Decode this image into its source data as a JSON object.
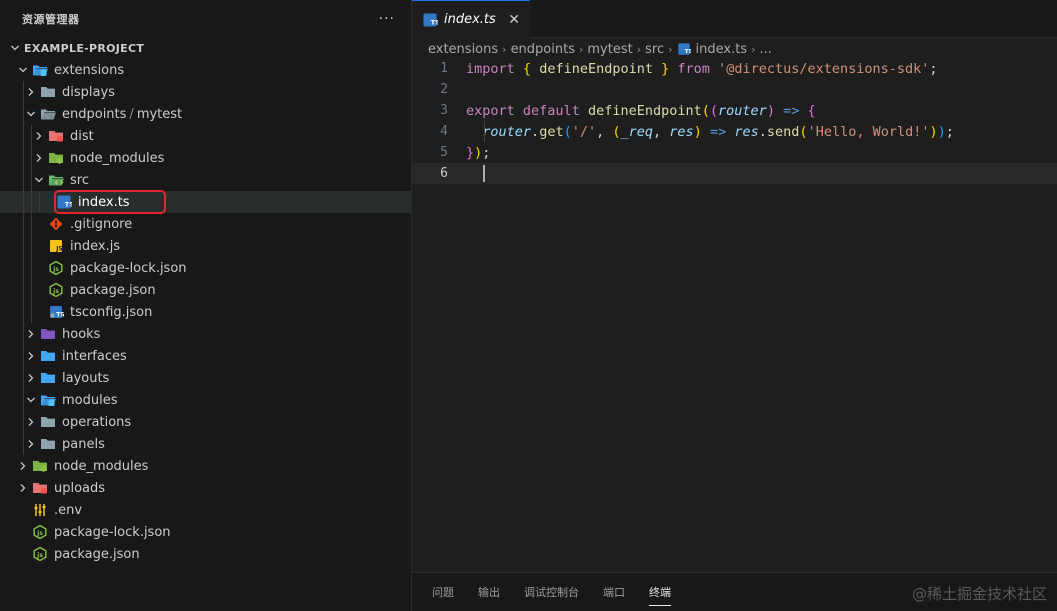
{
  "sidebar": {
    "title": "资源管理器",
    "more": "···",
    "tree": [
      {
        "label": "EXAMPLE-PROJECT",
        "depth": 0,
        "chevron": "down",
        "icon": "none",
        "bold": true
      },
      {
        "label": "extensions",
        "depth": 1,
        "chevron": "down",
        "icon": "folder-ext-open"
      },
      {
        "label": "displays",
        "depth": 2,
        "chevron": "right",
        "icon": "folder-gray"
      },
      {
        "label": "endpoints",
        "extra": "mytest",
        "depth": 2,
        "chevron": "down",
        "icon": "folder-gray-open"
      },
      {
        "label": "dist",
        "depth": 3,
        "chevron": "right",
        "icon": "folder-red"
      },
      {
        "label": "node_modules",
        "depth": 3,
        "chevron": "right",
        "icon": "folder-green"
      },
      {
        "label": "src",
        "depth": 3,
        "chevron": "down",
        "icon": "folder-src-open"
      },
      {
        "label": "index.ts",
        "depth": 4,
        "chevron": "none",
        "icon": "ts-file",
        "selected": true
      },
      {
        "label": ".gitignore",
        "depth": 3,
        "chevron": "none",
        "icon": "git-file"
      },
      {
        "label": "index.js",
        "depth": 3,
        "chevron": "none",
        "icon": "js-file"
      },
      {
        "label": "package-lock.json",
        "depth": 3,
        "chevron": "none",
        "icon": "node-file"
      },
      {
        "label": "package.json",
        "depth": 3,
        "chevron": "none",
        "icon": "node-file"
      },
      {
        "label": "tsconfig.json",
        "depth": 3,
        "chevron": "none",
        "icon": "tsconfig-file"
      },
      {
        "label": "hooks",
        "depth": 2,
        "chevron": "right",
        "icon": "folder-purple"
      },
      {
        "label": "interfaces",
        "depth": 2,
        "chevron": "right",
        "icon": "folder-blue"
      },
      {
        "label": "layouts",
        "depth": 2,
        "chevron": "right",
        "icon": "folder-blue"
      },
      {
        "label": "modules",
        "depth": 2,
        "chevron": "down",
        "icon": "folder-ext-open"
      },
      {
        "label": "operations",
        "depth": 2,
        "chevron": "right",
        "icon": "folder-gray"
      },
      {
        "label": "panels",
        "depth": 2,
        "chevron": "right",
        "icon": "folder-gray"
      },
      {
        "label": "node_modules",
        "depth": 1,
        "chevron": "right",
        "icon": "folder-green"
      },
      {
        "label": "uploads",
        "depth": 1,
        "chevron": "right",
        "icon": "folder-red"
      },
      {
        "label": ".env",
        "depth": 1,
        "chevron": "none",
        "icon": "env-file"
      },
      {
        "label": "package-lock.json",
        "depth": 1,
        "chevron": "none",
        "icon": "node-file"
      },
      {
        "label": "package.json",
        "depth": 1,
        "chevron": "none",
        "icon": "node-file"
      }
    ]
  },
  "editor": {
    "tab": {
      "label": "index.ts",
      "close": "✕",
      "icon": "ts-file"
    },
    "breadcrumb": [
      "extensions",
      "endpoints",
      "mytest",
      "src",
      "index.ts",
      "..."
    ],
    "lines": [
      {
        "num": "1",
        "tokens": [
          [
            "kw",
            "import"
          ],
          [
            "pun",
            " "
          ],
          [
            "brace1",
            "{"
          ],
          [
            "pun",
            " "
          ],
          [
            "fn",
            "defineEndpoint"
          ],
          [
            "pun",
            " "
          ],
          [
            "brace1",
            "}"
          ],
          [
            "pun",
            " "
          ],
          [
            "kw",
            "from"
          ],
          [
            "pun",
            " "
          ],
          [
            "str",
            "'@directus/extensions-sdk'"
          ],
          [
            "pun",
            ";"
          ]
        ]
      },
      {
        "num": "2",
        "tokens": []
      },
      {
        "num": "3",
        "tokens": [
          [
            "kw",
            "export"
          ],
          [
            "pun",
            " "
          ],
          [
            "kw",
            "default"
          ],
          [
            "pun",
            " "
          ],
          [
            "fn",
            "defineEndpoint"
          ],
          [
            "brace1",
            "("
          ],
          [
            "brace2",
            "("
          ],
          [
            "param",
            "router"
          ],
          [
            "brace2",
            ")"
          ],
          [
            "pun",
            " "
          ],
          [
            "kw2",
            "=>"
          ],
          [
            "pun",
            " "
          ],
          [
            "brace2",
            "{"
          ]
        ]
      },
      {
        "num": "4",
        "tokens": [
          [
            "pun",
            "  "
          ],
          [
            "var",
            "router"
          ],
          [
            "pun",
            "."
          ],
          [
            "fn",
            "get"
          ],
          [
            "brace3",
            "("
          ],
          [
            "str",
            "'/'"
          ],
          [
            "pun",
            ", "
          ],
          [
            "brace1",
            "("
          ],
          [
            "param",
            "_req"
          ],
          [
            "pun",
            ", "
          ],
          [
            "param",
            "res"
          ],
          [
            "brace1",
            ")"
          ],
          [
            "pun",
            " "
          ],
          [
            "kw2",
            "=>"
          ],
          [
            "pun",
            " "
          ],
          [
            "var",
            "res"
          ],
          [
            "pun",
            "."
          ],
          [
            "fn",
            "send"
          ],
          [
            "brace1",
            "("
          ],
          [
            "str",
            "'Hello, World!'"
          ],
          [
            "brace1",
            ")"
          ],
          [
            "brace3",
            ")"
          ],
          [
            "pun",
            ";"
          ]
        ]
      },
      {
        "num": "5",
        "tokens": [
          [
            "brace2",
            "}"
          ],
          [
            "brace1",
            ")"
          ],
          [
            "pun",
            ";"
          ]
        ]
      },
      {
        "num": "6",
        "tokens": [],
        "current": true
      }
    ]
  },
  "panel": {
    "tabs": [
      "问题",
      "输出",
      "调试控制台",
      "端口",
      "终端"
    ],
    "active": 4,
    "watermark": "@稀土掘金技术社区"
  },
  "colors": {
    "accent": "#1f6feb",
    "highlight_box": "#e0262f",
    "ts_blue": "#3178c6"
  }
}
